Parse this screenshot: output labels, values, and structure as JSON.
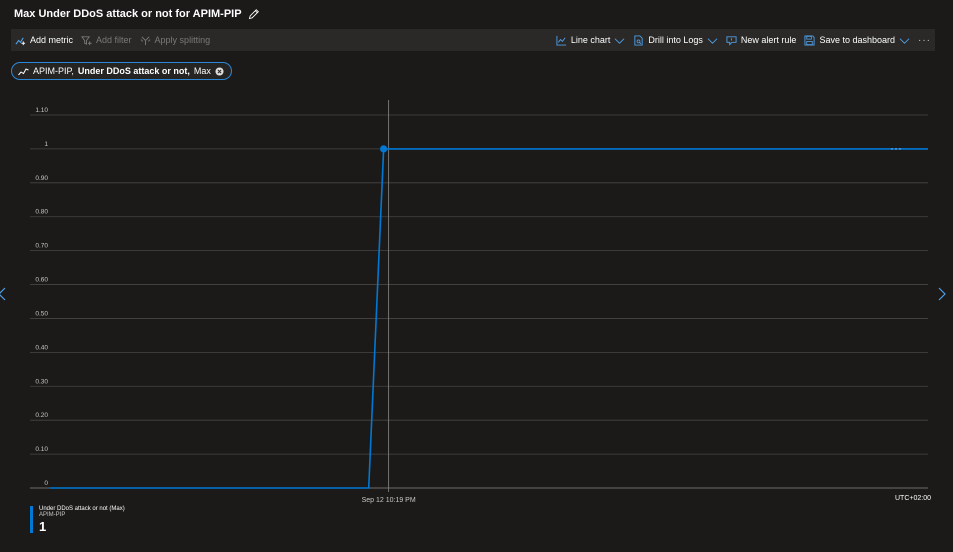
{
  "title": "Max Under DDoS attack or not for APIM-PIP",
  "toolbar": {
    "add_metric": "Add metric",
    "add_filter": "Add filter",
    "apply_splitting": "Apply splitting",
    "line_chart": "Line chart",
    "drill_into_logs": "Drill into Logs",
    "new_alert_rule": "New alert rule",
    "save_to_dashboard": "Save to dashboard",
    "more": "···"
  },
  "metric_pill": {
    "resource": "APIM-PIP,",
    "metric": "Under DDoS attack or not,",
    "aggregation": "Max"
  },
  "chart_data": {
    "type": "line",
    "y_ticks": [
      "0",
      "0.10",
      "0.20",
      "0.30",
      "0.40",
      "0.50",
      "0.60",
      "0.70",
      "0.80",
      "0.90",
      "1",
      "1.10"
    ],
    "ylim": [
      0,
      1.1
    ],
    "x_tick_label": "Sep 12 10:19 PM",
    "timezone_label": "UTC+02:00",
    "grid": true,
    "series": [
      {
        "name": "Under DDoS attack or not (Max)",
        "color": "#0078d4",
        "points": [
          {
            "t": 0.0,
            "v": 0
          },
          {
            "t": 0.363,
            "v": 0
          },
          {
            "t": 0.38,
            "v": 1
          },
          {
            "t": 1.0,
            "v": 1
          }
        ],
        "highlight_t": 0.38
      }
    ]
  },
  "legend": {
    "line1": "Under DDoS attack or not (Max)",
    "line2": "APIM-PIP",
    "value": "1"
  }
}
